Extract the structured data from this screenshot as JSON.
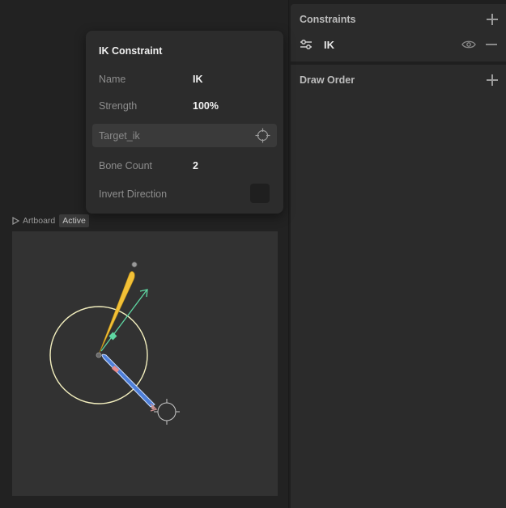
{
  "popup": {
    "title": "IK Constraint",
    "props": {
      "name_label": "Name",
      "name_value": "IK",
      "strength_label": "Strength",
      "strength_value": "100%",
      "target_placeholder": "Target_ik",
      "bone_count_label": "Bone Count",
      "bone_count_value": "2",
      "invert_label": "Invert Direction",
      "invert_checked": false
    }
  },
  "artboard": {
    "name": "Artboard",
    "status": "Active"
  },
  "constraints_panel": {
    "title": "Constraints",
    "items": [
      {
        "label": "IK",
        "icon": "sliders-icon",
        "visible": true
      }
    ]
  },
  "draw_order_panel": {
    "title": "Draw Order"
  },
  "colors": {
    "bone_upper": "#f2c037",
    "bone_lower": "#4e7fd8",
    "ik_arrow": "#5fd7a3",
    "circle": "#f4f0bf",
    "target_handle": "#c9908f"
  }
}
